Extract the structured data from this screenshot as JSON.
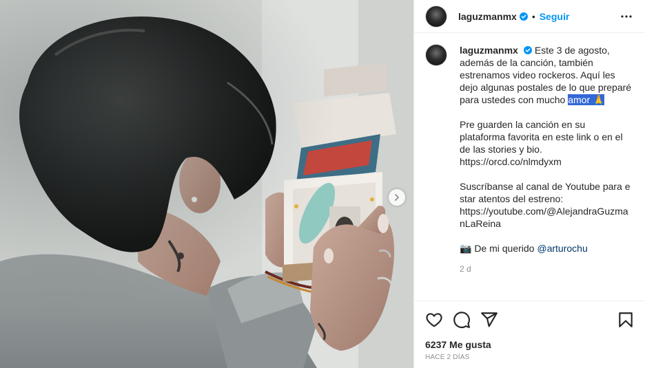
{
  "post": {
    "username": "laguzmanmx",
    "follow_label": "Seguir",
    "separator": "•",
    "caption": {
      "p1_before": "Este 3 de agosto, además de la canción, también estrenamos video rockeros. Aquí les dejo algunas postales de lo que preparé para ustedes con mucho ",
      "p1_highlight": "amor 🙏",
      "p2": "Pre guarden la canción en su plataforma favorita en este link o en el de las stories y bio.\nhttps://orcd.co/nlmdyxm",
      "p3": "Suscríbanse al canal de Youtube para estar atentos del estreno:\nhttps://youtube.com/@AlejandraGuzmanLaReina",
      "p4_prefix": "📷 De mi querido ",
      "p4_mention": "@arturochu"
    },
    "time": "2 d",
    "likes": "6237 Me gusta",
    "ago": "Hace 2 días"
  },
  "icons": {
    "verified": "verified-badge-icon",
    "more": "more-options-icon",
    "like": "heart-icon",
    "comment": "comment-icon",
    "share": "send-icon",
    "save": "bookmark-icon",
    "next": "chevron-right-icon"
  },
  "colors": {
    "accent": "#0095f6",
    "highlight": "#3367d6",
    "mention": "#00376b",
    "muted": "#8e8e8e"
  }
}
